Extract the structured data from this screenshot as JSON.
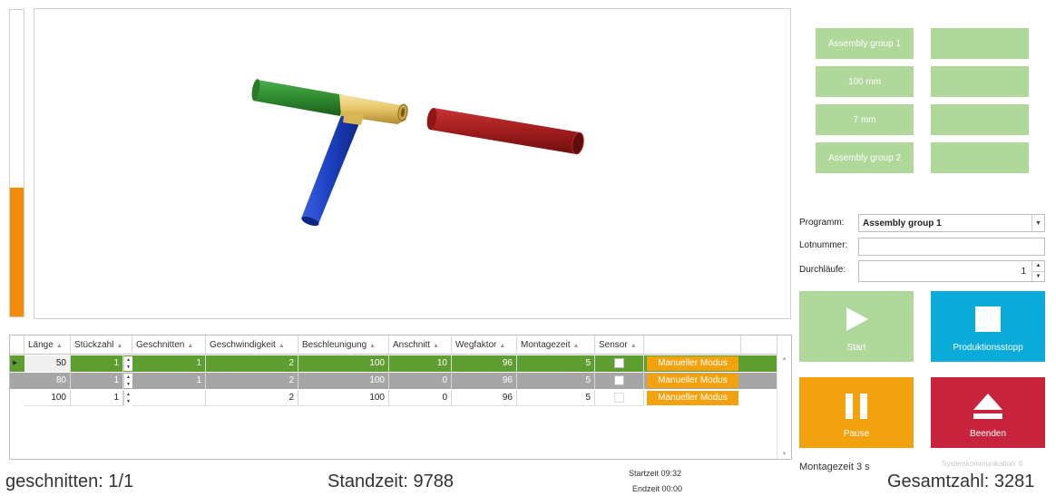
{
  "progress": {
    "fraction": 0.42,
    "color": "#f28c0f"
  },
  "viewport": {
    "colors": {
      "green_pipe": "#2f8a2f",
      "blue_pipe": "#1a3fbf",
      "red_pipe": "#a01c1c",
      "fitting": "#e6c466"
    }
  },
  "tiles": [
    {
      "label": "Assembly group 1"
    },
    {
      "label": ""
    },
    {
      "label": "100 mm"
    },
    {
      "label": ""
    },
    {
      "label": "7 mm"
    },
    {
      "label": ""
    },
    {
      "label": "Assembly group 2"
    },
    {
      "label": ""
    }
  ],
  "form": {
    "programm_label": "Programm:",
    "programm_value": "Assembly group 1",
    "lot_label": "Lotnummer:",
    "lot_value": "",
    "runs_label": "Durchläufe:",
    "runs_value": "1"
  },
  "buttons": {
    "start": "Start",
    "stop": "Produktionsstopp",
    "pause": "Pause",
    "quit": "Beenden"
  },
  "table": {
    "headers": [
      "Länge",
      "Stückzahl",
      "Geschnitten",
      "Geschwindigkeit",
      "Beschleunigung",
      "Anschnitt",
      "Wegfaktor",
      "Montagezeit",
      "Sensor"
    ],
    "rows": [
      {
        "laenge": "50",
        "stueckzahl": "1",
        "geschnitten": "1",
        "geschwindigkeit": "2",
        "beschleunigung": "100",
        "anschnitt": "10",
        "wegfaktor": "96",
        "montagezeit": "5",
        "mode": "Manueller Modus"
      },
      {
        "laenge": "80",
        "stueckzahl": "1",
        "geschnitten": "1",
        "geschwindigkeit": "2",
        "beschleunigung": "100",
        "anschnitt": "0",
        "wegfaktor": "96",
        "montagezeit": "5",
        "mode": "Manueller Modus"
      },
      {
        "laenge": "100",
        "stueckzahl": "1",
        "geschnitten": "",
        "geschwindigkeit": "2",
        "beschleunigung": "100",
        "anschnitt": "0",
        "wegfaktor": "96",
        "montagezeit": "5",
        "mode": "Manueller Modus"
      }
    ]
  },
  "footer": {
    "cut": "geschnitten: 1/1",
    "standzeit": "Standzeit: 9788",
    "startzeit": "Startzeit 09:32",
    "endzeit": "Endzeit 00:00",
    "montagezeit": "Montagezeit 3 s",
    "systemkommunikation": "Systemkommunikation: 6",
    "gesamtzahl": "Gesamtzahl: 3281"
  }
}
